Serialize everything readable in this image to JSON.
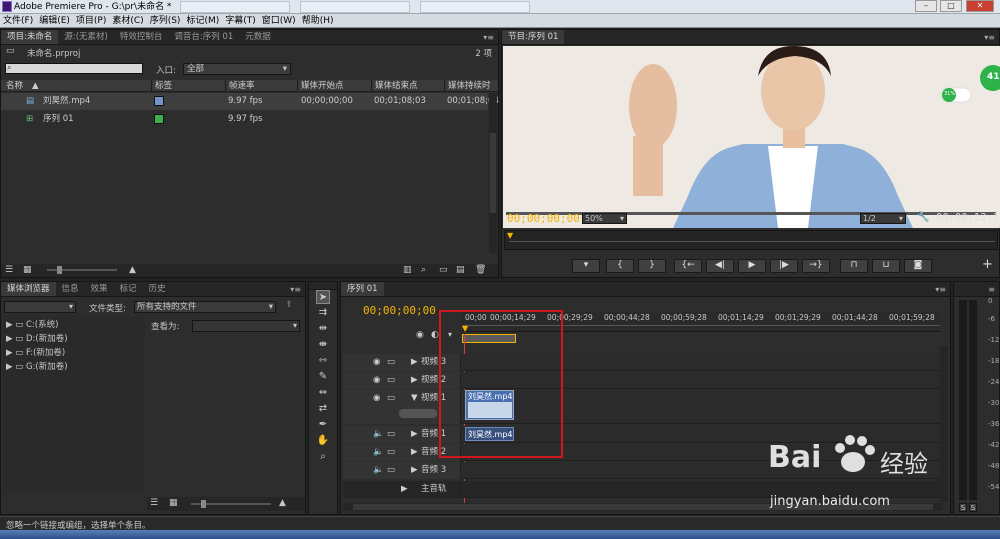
{
  "window": {
    "title": "Adobe Premiere Pro - G:\\pr\\未命名 *"
  },
  "menubar": [
    "文件(F)",
    "编辑(E)",
    "项目(P)",
    "素材(C)",
    "序列(S)",
    "标记(M)",
    "字幕(T)",
    "窗口(W)",
    "帮助(H)"
  ],
  "project_panel": {
    "tabs": [
      "项目:未命名",
      "源:(无素材)",
      "特效控制台",
      "调音台:序列 01",
      "元数据"
    ],
    "file_name": "未命名.prproj",
    "item_count": "2 项",
    "search_placeholder": "",
    "entry_label": "入口:",
    "entry_value": "全部",
    "columns": [
      "名称",
      "标签",
      "帧速率",
      "媒体开始点",
      "媒体结束点",
      "媒体持续时"
    ],
    "rows": [
      {
        "name": "刘昊然.mp4",
        "label_color": "#6f95c8",
        "fps": "9.97 fps",
        "start": "00;00;00;00",
        "end": "00;01;08;03",
        "dur": "00;01;08;04"
      },
      {
        "name": "序列 01",
        "label_color": "#3db04a",
        "fps": "9.97 fps",
        "start": "",
        "end": "",
        "dur": ""
      }
    ]
  },
  "program_monitor": {
    "tab": "节目:序列 01",
    "timecode_current": "00;00;00;00",
    "zoom": "50%",
    "resolution": "1/2",
    "timecode_duration": "00;00;13;18",
    "overlay_badge": "41",
    "overlay_small": "31%"
  },
  "media_browser": {
    "tabs": [
      "媒体浏览器",
      "信息",
      "效果",
      "标记",
      "历史"
    ],
    "file_type_label": "文件类型:",
    "file_type_value": "所有支持的文件",
    "view_as_label": "查看为:",
    "drives": [
      "C:(系统)",
      "D:(新加卷)",
      "F:(新加卷)",
      "G:(新加卷)"
    ]
  },
  "timeline": {
    "tab": "序列 01",
    "timecode": "00;00;00;00",
    "ruler": [
      "00;00",
      "00;00;14;29",
      "00;00;29;29",
      "00;00;44;28",
      "00;00;59;28",
      "00;01;14;29",
      "00;01;29;29",
      "00;01;44;28",
      "00;01;59;28"
    ],
    "tracks": {
      "v3": "视频 3",
      "v2": "视频 2",
      "v1": "视频 1",
      "a1": "音频 1",
      "a2": "音频 2",
      "a3": "音频 3",
      "master": "主音轨"
    },
    "clip_name": "刘昊然.mp4"
  },
  "audio_meter": {
    "db_labels": [
      "0",
      "-6",
      "-12",
      "-18",
      "-24",
      "-30",
      "-36",
      "-42",
      "-48",
      "-54"
    ],
    "solo": "S"
  },
  "statusbar": {
    "text": "忽略一个链接或编组，选择单个条目。"
  },
  "watermark": {
    "text1": "Bai",
    "text2": "经验",
    "url": "jingyan.baidu.com"
  },
  "colors": {
    "accent": "#f5b400",
    "clip_video": "#4a6fb0",
    "highlight": "#d0191e"
  }
}
